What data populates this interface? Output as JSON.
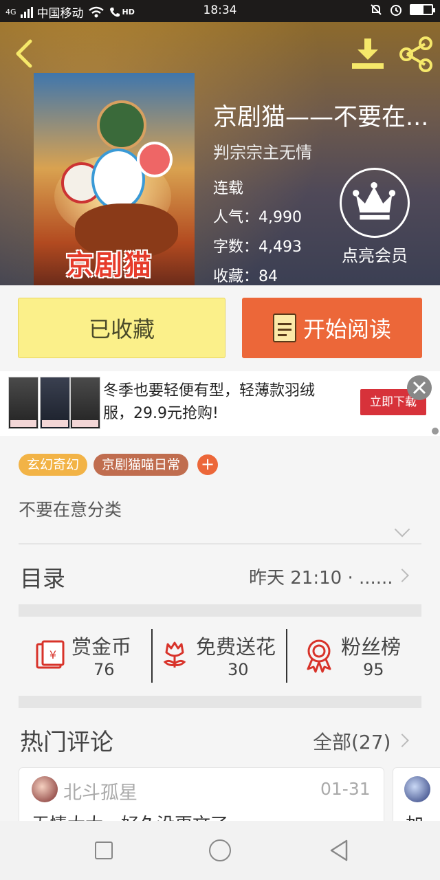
{
  "status_bar": {
    "network": "4G",
    "carrier": "中国移动",
    "hd": "HD",
    "time": "18:34",
    "battery_level": 0.6
  },
  "header": {
    "book_title": "京剧猫——不要在...",
    "author": "判宗宗主无情",
    "status": "连载",
    "popularity": "人气：4,990",
    "word_count": "字数：4,493",
    "favorites": "收藏：84",
    "cover_logo": "京剧猫",
    "vip_label": "点亮会员"
  },
  "actions": {
    "collected_label": "已收藏",
    "read_label": "开始阅读"
  },
  "ad": {
    "text": "冬季也要轻便有型，轻薄款羽绒服，29.9元抢购!",
    "download_label": "立即下载",
    "thumb_price": "29.9"
  },
  "tags": [
    "玄幻奇幻",
    "京剧猫喵日常"
  ],
  "tag_add": "+",
  "description": "不要在意分类",
  "toc": {
    "title": "目录",
    "update": "昨天 21:10 · ......"
  },
  "stats": [
    {
      "label": "赏金币",
      "value": "76",
      "icon": "red-envelope-icon"
    },
    {
      "label": "免费送花",
      "value": "30",
      "icon": "flower-icon"
    },
    {
      "label": "粉丝榜",
      "value": "95",
      "icon": "medal-icon"
    }
  ],
  "comments": {
    "title": "热门评论",
    "all_label": "全部(27)",
    "items": [
      {
        "user": "北斗孤星",
        "date": "01-31",
        "text": "无情大大，好久没更文了"
      },
      {
        "text": "加"
      }
    ]
  },
  "colors": {
    "accent_orange": "#ec6739",
    "collect_yellow": "#fbf08a",
    "tag_yellow": "#f2b346",
    "tag_brown": "#c06d4f",
    "ad_red": "#d7323a"
  }
}
